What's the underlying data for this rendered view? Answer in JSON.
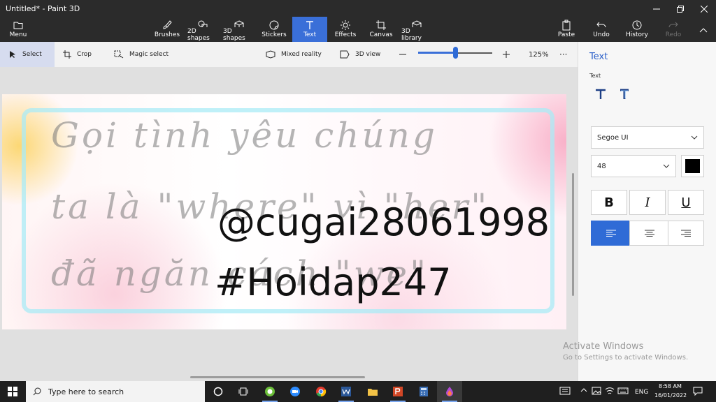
{
  "window": {
    "title": "Untitled* - Paint 3D"
  },
  "ribbon": {
    "menu": "Menu",
    "tools": [
      {
        "id": "brushes",
        "label": "Brushes"
      },
      {
        "id": "2d-shapes",
        "label": "2D shapes"
      },
      {
        "id": "3d-shapes",
        "label": "3D shapes"
      },
      {
        "id": "stickers",
        "label": "Stickers"
      },
      {
        "id": "text",
        "label": "Text"
      },
      {
        "id": "effects",
        "label": "Effects"
      },
      {
        "id": "canvas",
        "label": "Canvas"
      },
      {
        "id": "3d-library",
        "label": "3D library"
      }
    ],
    "actions": {
      "paste": "Paste",
      "undo": "Undo",
      "history": "History",
      "redo": "Redo"
    }
  },
  "toolbar": {
    "select": "Select",
    "crop": "Crop",
    "magic_select": "Magic select",
    "mixed_reality": "Mixed reality",
    "view_3d": "3D view",
    "zoom_label": "125%",
    "zoom_slider_fraction": 0.5,
    "more": "···"
  },
  "canvas": {
    "script_lines": [
      "Gọi tình yêu chúng",
      "ta là \"where\" vì \"her\"",
      "đã ngăn cách \"we\""
    ],
    "overlay_lines": [
      "@cugai28061998",
      "#Hoidap247"
    ]
  },
  "panel": {
    "title": "Text",
    "section_label": "Text",
    "font_family": "Segoe UI",
    "font_size": "48",
    "text_color": "#000000",
    "bold": "B",
    "italic": "I",
    "underline": "U"
  },
  "watermark": {
    "line1": "Activate Windows",
    "line2": "Go to Settings to activate Windows."
  },
  "taskbar": {
    "search_placeholder": "Type here to search",
    "language": "ENG",
    "time": "8:58 AM",
    "date": "16/01/2022"
  },
  "colors": {
    "accent": "#2f6bd6",
    "ribbon_bg": "#2b2b2b",
    "taskbar_bg": "#1f1f1f"
  }
}
